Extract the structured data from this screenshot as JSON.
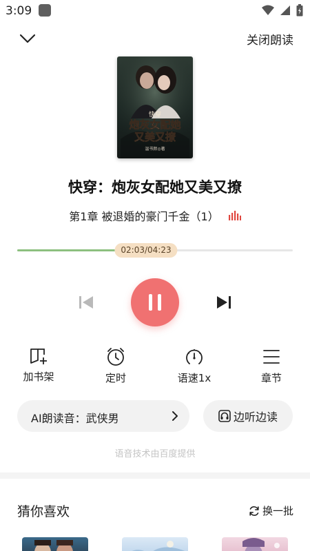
{
  "status_bar": {
    "time": "3:09",
    "icons": [
      "app-notification-icon",
      "wifi-icon",
      "cellular-signal-icon",
      "battery-icon"
    ]
  },
  "header": {
    "back_icon": "chevron-down-icon",
    "close_read_label": "关闭朗读"
  },
  "book": {
    "cover_line1": "快穿",
    "cover_line2": "炮灰女配她",
    "cover_line3": "又美又撩",
    "cover_author": "温书颜◎著",
    "title": "快穿：炮灰女配她又美又撩",
    "chapter": "第1章 被退婚的豪门千金（1）",
    "chapter_icon": "audio-playing-icon"
  },
  "player": {
    "time_display": "02:03/04:23",
    "elapsed_seconds": 123,
    "total_seconds": 263,
    "progress_fraction": 0.468,
    "state": "playing",
    "prev_icon": "skip-previous-icon",
    "play_pause_icon": "pause-icon",
    "next_icon": "skip-next-icon"
  },
  "actions": [
    {
      "label": "加书架",
      "icon": "add-bookshelf-icon"
    },
    {
      "label": "定时",
      "icon": "alarm-clock-icon"
    },
    {
      "label": "语速1x",
      "icon": "speedometer-icon"
    },
    {
      "label": "章节",
      "icon": "menu-lines-icon"
    }
  ],
  "voice": {
    "label": "AI朗读音：武侠男",
    "chevron_icon": "chevron-right-icon"
  },
  "listen_read": {
    "label": "边听边读",
    "icon": "headphones-icon"
  },
  "credit": "语音技术由百度提供",
  "recommend": {
    "title": "猜你喜欢",
    "refresh_label": "换一批",
    "refresh_icon": "refresh-icon"
  },
  "colors": {
    "accent_red": "#f07171",
    "progress_green": "#8cc07f",
    "time_badge_bg": "#f5dfc3",
    "pill_bg": "#f2f2f2",
    "muted_text": "#c4c4c4"
  }
}
